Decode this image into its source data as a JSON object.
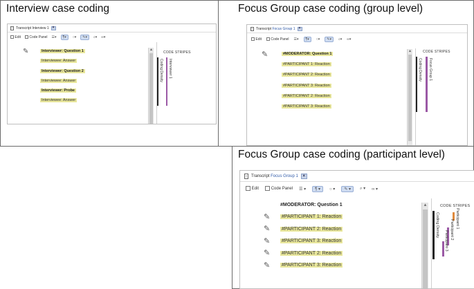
{
  "panels": {
    "top_left": {
      "title": "Interview case coding",
      "tab_prefix": "Transcript",
      "tab_name": "Interview 1",
      "toolbar": {
        "edit": "Edit",
        "code_panel": "Code Panel"
      },
      "lines": [
        {
          "text": "Interviewer: Question 1",
          "bold": true
        },
        {
          "text": "Interviewee: Answer",
          "bold": false
        },
        {
          "text": "Interviewer: Question 2",
          "bold": true
        },
        {
          "text": "Interviewee: Answer",
          "bold": false
        },
        {
          "text": "Interviewer: Probe",
          "bold": true
        },
        {
          "text": "Interviewee: Answer",
          "bold": false
        }
      ],
      "stripes": {
        "title": "CODE STRIPES",
        "density": "Coding Density",
        "labels": [
          "Interviewer 1"
        ]
      }
    },
    "top_right": {
      "title": "Focus Group case coding (group level)",
      "tab_prefix": "Transcript",
      "tab_name": "Focus Group 1",
      "toolbar": {
        "edit": "Edit",
        "code_panel": "Code Panel"
      },
      "lines": [
        {
          "text": "#MODERATOR: Question 1",
          "bold": true
        },
        {
          "text": "#PARTICIPANT 1: Reaction",
          "bold": false
        },
        {
          "text": "#PARTICIPANT 2: Reaction",
          "bold": false
        },
        {
          "text": "#PARTICIPANT 3: Reaction",
          "bold": false
        },
        {
          "text": "#PARTICIPANT 2: Reaction",
          "bold": false
        },
        {
          "text": "#PARTICIPANT 3: Reaction",
          "bold": false
        }
      ],
      "stripes": {
        "title": "CODE STRIPES",
        "density": "Coding Density",
        "labels": [
          "Focus Group 1"
        ]
      }
    },
    "bottom_right": {
      "title": "Focus Group case coding (participant level)",
      "tab_prefix": "Transcript",
      "tab_name": "Focus Group 1",
      "toolbar": {
        "edit": "Edit",
        "code_panel": "Code Panel"
      },
      "lines": [
        {
          "text": "#MODERATOR: Question 1",
          "bold": true
        },
        {
          "text": "#PARTICIPANT 1: Reaction",
          "bold": false
        },
        {
          "text": "#PARTICIPANT 2: Reaction",
          "bold": false
        },
        {
          "text": "#PARTICIPANT 3: Reaction",
          "bold": false
        },
        {
          "text": "#PARTICIPANT 2: Reaction",
          "bold": false
        },
        {
          "text": "#PARTICIPANT 3: Reaction",
          "bold": false
        }
      ],
      "stripes": {
        "title": "CODE STRIPES",
        "density": "Coding Density",
        "labels": [
          "Participant 1",
          "Participant 2",
          "Participant 3"
        ]
      }
    }
  },
  "colors": {
    "highlight": "#e9e79c",
    "stripe_purple": "#9b59a5",
    "stripe_orange": "#e08a3c",
    "tab_accent": "#2f5aa8"
  }
}
